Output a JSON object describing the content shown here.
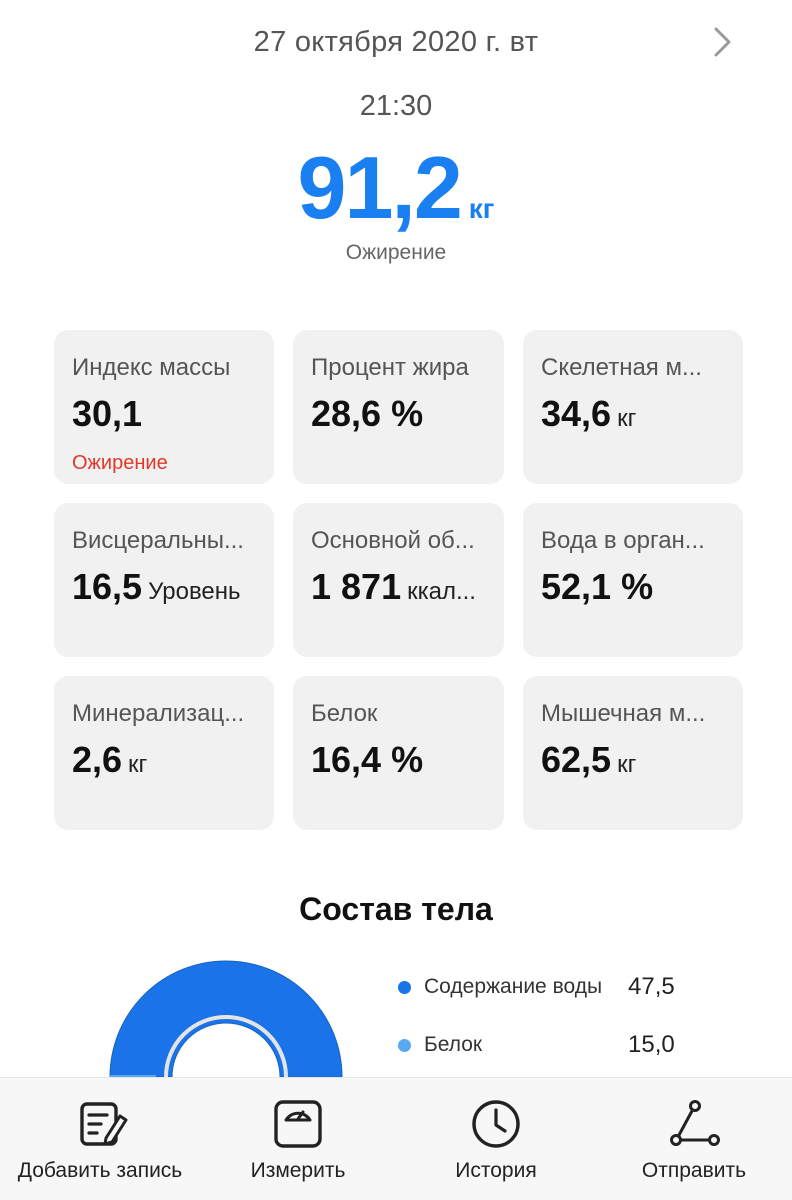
{
  "header": {
    "date": "27 октября 2020 г. вт",
    "time": "21:30",
    "weight_value": "91,2",
    "weight_unit": "кг",
    "weight_status": "Ожирение"
  },
  "metrics": [
    {
      "label": "Индекс массы",
      "value": "30,1",
      "unit": "",
      "status": "Ожирение"
    },
    {
      "label": "Процент жира",
      "value": "28,6 %",
      "unit": "",
      "status": ""
    },
    {
      "label": "Скелетная м...",
      "value": "34,6",
      "unit": "кг",
      "status": ""
    },
    {
      "label": "Висцеральны...",
      "value": "16,5",
      "unit": "Уровень",
      "status": ""
    },
    {
      "label": "Основной об...",
      "value": "1 871",
      "unit": "ккал...",
      "status": ""
    },
    {
      "label": "Вода в орган...",
      "value": "52,1 %",
      "unit": "",
      "status": ""
    },
    {
      "label": "Минерализац...",
      "value": "2,6",
      "unit": "кг",
      "status": ""
    },
    {
      "label": "Белок",
      "value": "16,4 %",
      "unit": "",
      "status": ""
    },
    {
      "label": "Мышечная м...",
      "value": "62,5",
      "unit": "кг",
      "status": ""
    }
  ],
  "composition": {
    "title": "Состав тела",
    "legend": [
      {
        "label": "Содержание воды",
        "value": "47,5",
        "color": "#1a73e8"
      },
      {
        "label": "Белок",
        "value": "15,0",
        "color": "#5aa7f2"
      }
    ]
  },
  "colors": {
    "accent": "#1a7ff0",
    "warning": "#e0392b",
    "card_bg": "#f1f1f1"
  },
  "nav": [
    {
      "label": "Добавить запись",
      "icon": "edit-note-icon"
    },
    {
      "label": "Измерить",
      "icon": "scale-icon"
    },
    {
      "label": "История",
      "icon": "clock-icon"
    },
    {
      "label": "Отправить",
      "icon": "share-icon"
    }
  ]
}
